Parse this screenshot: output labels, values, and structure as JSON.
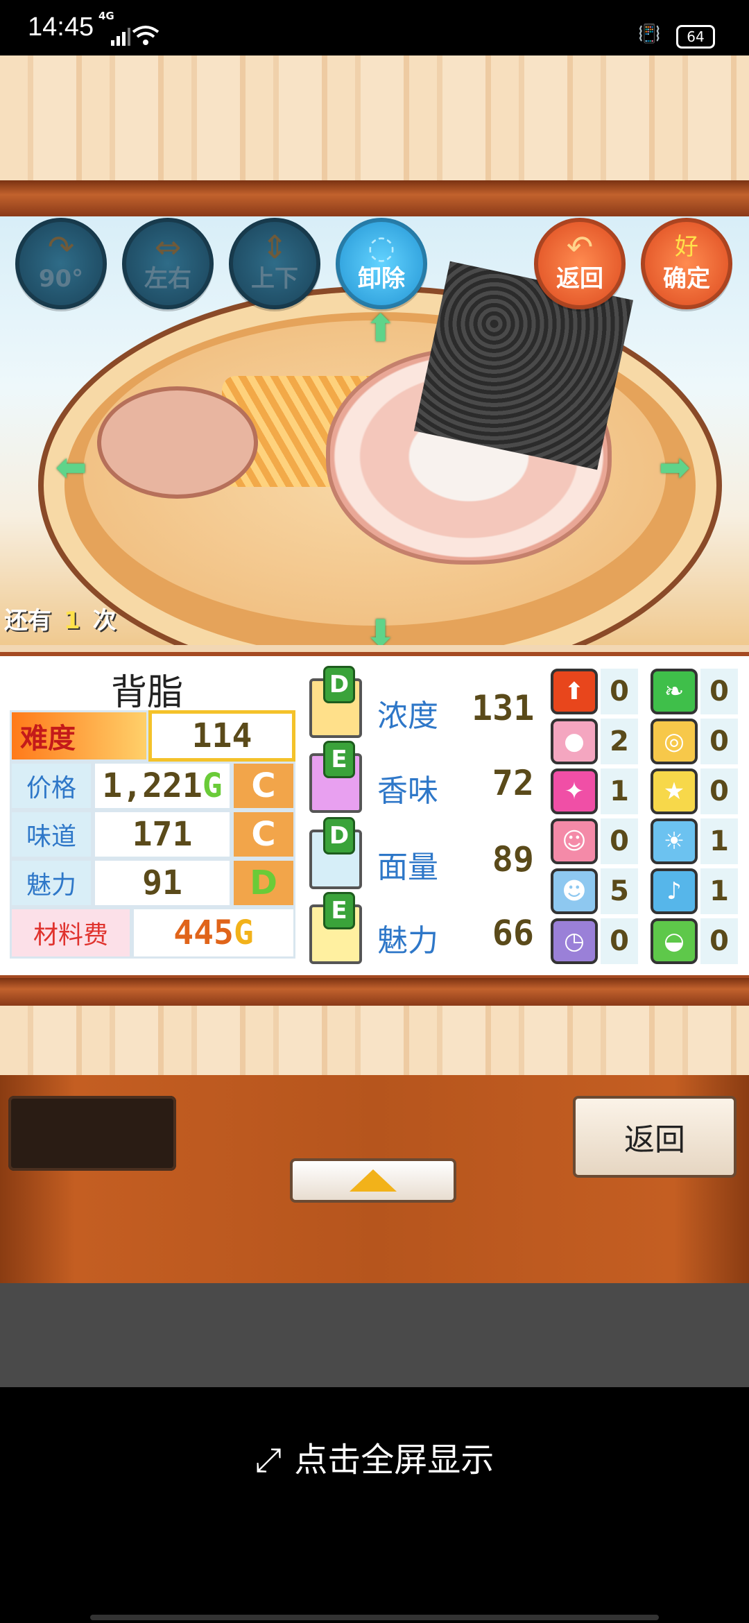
{
  "status_bar": {
    "time": "14:45",
    "network": "4G",
    "battery": "64"
  },
  "toolbar": {
    "rotate_label": "90°",
    "flip_h_label": "左右",
    "flip_v_label": "上下",
    "remove_label": "卸除",
    "return_label": "返回",
    "confirm_label": "确定",
    "confirm_badge": "好"
  },
  "remaining": {
    "prefix": "还有",
    "count": "1",
    "suffix": "次"
  },
  "item": {
    "name": "背脂",
    "difficulty_label": "难度",
    "difficulty_value": "114",
    "rows": [
      {
        "label": "价格",
        "value": "1,221",
        "unit": "G",
        "grade": "C"
      },
      {
        "label": "味道",
        "value": "171",
        "unit": "",
        "grade": "C"
      },
      {
        "label": "魅力",
        "value": "91",
        "unit": "",
        "grade": "D"
      }
    ],
    "cost_label": "材料费",
    "cost_value": "445",
    "cost_unit": "G"
  },
  "params": [
    {
      "grade": "D",
      "label": "浓度",
      "value": "131"
    },
    {
      "grade": "E",
      "label": "香味",
      "value": "72"
    },
    {
      "grade": "D",
      "label": "面量",
      "value": "89"
    },
    {
      "grade": "E",
      "label": "魅力",
      "value": "66"
    }
  ],
  "badges": {
    "left": [
      {
        "icon": "up-arrow-icon",
        "color": "#e8461c",
        "count": "0"
      },
      {
        "icon": "gold-coin-icon",
        "color": "#f4a6c0",
        "count": "2"
      },
      {
        "icon": "sparkle-icon",
        "color": "#f04fa6",
        "count": "1"
      },
      {
        "icon": "girl-face-icon",
        "color": "#f48aa8",
        "count": "0"
      },
      {
        "icon": "boy-face-icon",
        "color": "#8ec8f0",
        "count": "5"
      },
      {
        "icon": "clock-icon",
        "color": "#9a80d8",
        "count": "0"
      }
    ],
    "right": [
      {
        "icon": "leaf-icon",
        "color": "#3fbf4a",
        "count": "0"
      },
      {
        "icon": "spiral-icon",
        "color": "#f7c84a",
        "count": "0"
      },
      {
        "icon": "star-icon",
        "color": "#f7d84a",
        "count": "0"
      },
      {
        "icon": "lightbulb-icon",
        "color": "#6cc2f0",
        "count": "1"
      },
      {
        "icon": "music-note-icon",
        "color": "#56b6ea",
        "count": "1"
      },
      {
        "icon": "bowl-icon",
        "color": "#5ec84a",
        "count": "0"
      }
    ]
  },
  "bottom": {
    "back_label": "返回"
  },
  "fullscreen_hint": "点击全屏显示"
}
